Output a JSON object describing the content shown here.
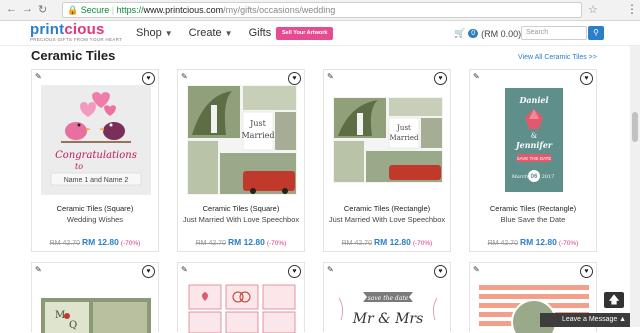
{
  "browser": {
    "secure_label": "Secure",
    "url_scheme": "https://",
    "url_host": "www.printcious.com",
    "url_path": "/my/gifts/occasions/wedding",
    "back_icon": "back-arrow-icon",
    "forward_icon": "forward-arrow-icon",
    "reload_icon": "reload-icon"
  },
  "header": {
    "logo_part1": "print",
    "logo_part2": "cious",
    "logo_tagline": "PRECIOUS GIFTS FROM YOUR HEART",
    "nav": [
      {
        "label": "Shop"
      },
      {
        "label": "Create"
      },
      {
        "label": "Gifts"
      }
    ],
    "sell_label": "Sell Your Artwork",
    "cart_count": "0",
    "cart_total": "(RM 0.00)",
    "search_placeholder": "Search",
    "colors": {
      "brand_blue": "#2b7ec7",
      "brand_pink": "#e2357e"
    }
  },
  "section": {
    "title": "Ceramic Tiles",
    "view_all": "View All Ceramic Tiles >>"
  },
  "products": [
    {
      "type": "Ceramic Tiles (Square)",
      "name": "Wedding Wishes",
      "old_price": "RM 42.70",
      "new_price": "RM 12.80",
      "discount": "(-70%)",
      "art": {
        "line1": "Congratulations",
        "line2": "to",
        "line3": "Name 1 and Name 2"
      }
    },
    {
      "type": "Ceramic Tiles (Square)",
      "name": "Just Married With Love Speechbox",
      "old_price": "RM 42.70",
      "new_price": "RM 12.80",
      "discount": "(-70%)",
      "art": {
        "line1": "Just",
        "line2": "Married"
      }
    },
    {
      "type": "Ceramic Tiles (Rectangle)",
      "name": "Just Married With Love Speechbox",
      "old_price": "RM 42.70",
      "new_price": "RM 12.80",
      "discount": "(-70%)",
      "art": {
        "line1": "Just",
        "line2": "Married"
      }
    },
    {
      "type": "Ceramic Tiles (Rectangle)",
      "name": "Blue Save the Date",
      "old_price": "RM 42.70",
      "new_price": "RM 12.80",
      "discount": "(-70%)",
      "art": {
        "line1": "Daniel",
        "line2": "&",
        "line3": "Jennifer",
        "line4": "SAVE THE DATE",
        "line5": "March",
        "line6": "06",
        "line7": "2017"
      }
    }
  ],
  "row2": [
    {
      "art": {
        "line1": "M",
        "line2": "Q",
        "line3": "Marcus · Queenie"
      }
    },
    {
      "art": {}
    },
    {
      "art": {
        "line1": "save the date",
        "line2": "Mr & Mrs"
      }
    },
    {
      "art": {}
    }
  ],
  "widgets": {
    "leave_message": "Leave a Message"
  }
}
